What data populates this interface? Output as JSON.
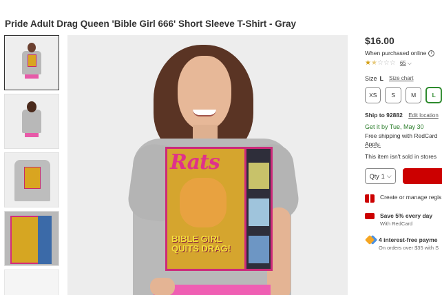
{
  "product": {
    "title": "Pride Adult Drag Queen 'Bible Girl 666' Short Sleeve T-Shirt - Gray",
    "price": "$16.00",
    "price_note": "When purchased online",
    "rating_value": 1.5,
    "rating_max": 5,
    "review_count": "65",
    "magazine_title": "Rats",
    "magazine_headline": "BIBLE GIRL QUITS DRAG!"
  },
  "size": {
    "label": "Size",
    "selected": "L",
    "chart_link": "Size chart",
    "options": [
      "XS",
      "S",
      "M",
      "L"
    ]
  },
  "shipping": {
    "ship_to_label": "Ship to 92882",
    "edit_location": "Edit location",
    "get_it": "Get it by Tue, May 30",
    "free_shipping": "Free shipping with RedCard",
    "apply": "Apply.",
    "store_note": "This item isn't sold in stores"
  },
  "qty": {
    "label": "Qty",
    "value": "1"
  },
  "promos": [
    {
      "icon": "gift-icon",
      "title": "Create or manage regis",
      "sub": ""
    },
    {
      "icon": "redcard-icon",
      "title": "Save 5% every day",
      "sub": "With RedCard"
    },
    {
      "icon": "payment-icon",
      "title": "4 interest-free payme",
      "sub": "On orders over $35 with S"
    }
  ],
  "colors": {
    "accent_red": "#cc0000",
    "green": "#2b7d2b",
    "star": "#d4a017"
  }
}
